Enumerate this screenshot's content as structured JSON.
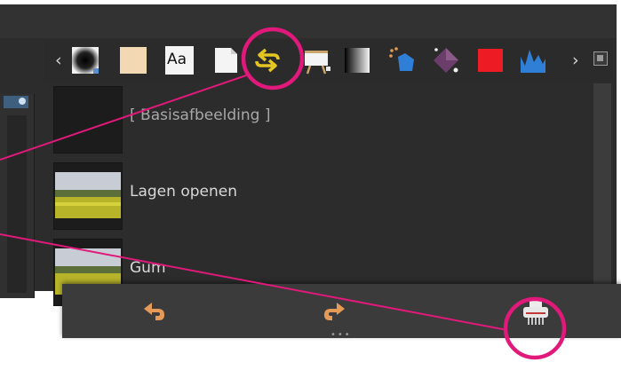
{
  "toolbar": {
    "nav_prev": "‹",
    "nav_next": "›",
    "text_tool_label": "Aa",
    "active_tool": "history-icon",
    "icons": [
      "vignette-icon",
      "color-fill-icon",
      "text-icon",
      "page-icon",
      "history-icon",
      "canvas-icon",
      "gradient-icon",
      "shape-icon",
      "gem-icon",
      "red-swatch-icon",
      "chart-icon"
    ]
  },
  "history": {
    "items": [
      {
        "label": "[ Basisafbeelding ]",
        "thumbnail": "empty"
      },
      {
        "label": "Lagen openen",
        "thumbnail": "landscape-photo"
      },
      {
        "label": "Gum",
        "thumbnail": "landscape-photo"
      }
    ]
  },
  "bottombar": {
    "dots": "•••",
    "icons": [
      "undo-icon",
      "redo-icon",
      "shredder-icon"
    ]
  },
  "colors": {
    "panel": "#2c2c2c",
    "accent_highlight": "#e0197a",
    "icon_orange": "#e59b57",
    "history_icon_yellow": "#e3c622"
  }
}
